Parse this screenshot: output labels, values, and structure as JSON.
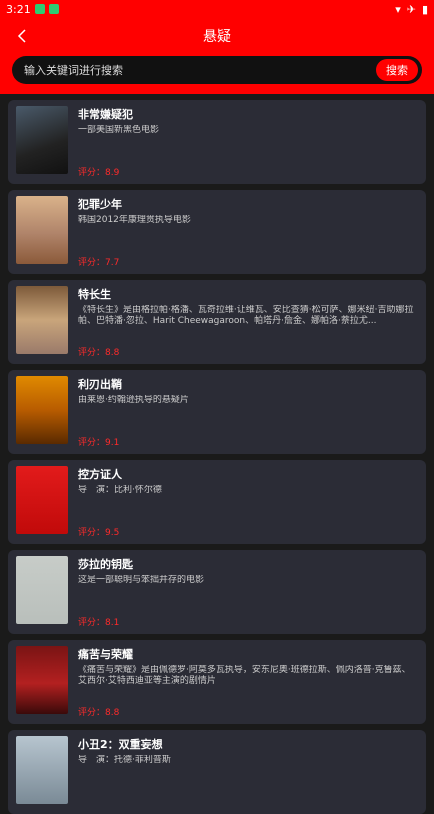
{
  "status_bar": {
    "time": "3:21"
  },
  "header": {
    "title": "悬疑"
  },
  "search": {
    "placeholder": "输入关键词进行搜索",
    "button_label": "搜索"
  },
  "movies": [
    {
      "title": "非常嫌疑犯",
      "desc": "一部美国新黑色电影",
      "rating": "评分：8.9"
    },
    {
      "title": "犯罪少年",
      "desc": "韩国2012年康理贯执导电影",
      "rating": "评分：7.7"
    },
    {
      "title": "特长生",
      "desc": "《特长生》是由格拉帕·格潘、瓦奇拉维·让维瓦、安比查猜·松可萨、娜米纽·吉助娜拉帕、巴特潘·忽拉、Harit Cheewagaroon、帕塔丹·詹金、娜帕洛·萘拉尤...",
      "rating": "评分：8.8"
    },
    {
      "title": "利刃出鞘",
      "desc": "由莱恩·约翰逊执导的悬疑片",
      "rating": "评分：9.1"
    },
    {
      "title": "控方证人",
      "desc": "导　演：比利·怀尔德",
      "rating": "评分：9.5"
    },
    {
      "title": "莎拉的钥匙",
      "desc": "这是一部聪明与笨拙并存的电影",
      "rating": "评分：8.1"
    },
    {
      "title": "痛苦与荣耀",
      "desc": "《痛苦与荣耀》是由佩德罗·阿莫多瓦执导，安东尼奥·班德拉斯、佩内洛普·克鲁兹、艾西尔·艾特西迪亚等主演的剧情片",
      "rating": "评分：8.8"
    },
    {
      "title": "小丑2：双重妄想",
      "desc": "导　演：托德·菲利普斯",
      "rating": ""
    }
  ]
}
